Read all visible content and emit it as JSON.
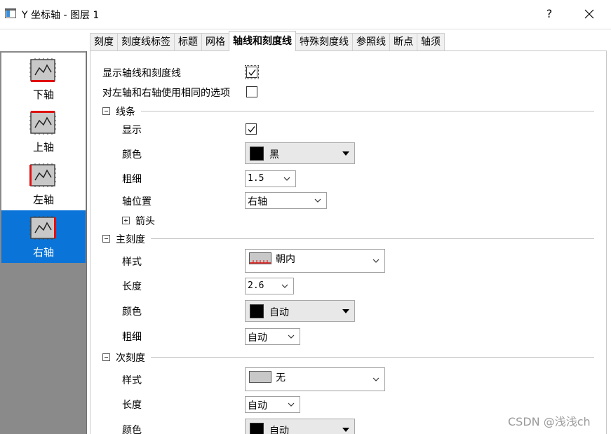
{
  "window": {
    "title": "Y 坐标轴 - 图层 1",
    "help_label": "?",
    "icons": {
      "app": "window-icon",
      "close": "close-icon"
    }
  },
  "tabs": [
    {
      "label": "刻度",
      "active": false
    },
    {
      "label": "刻度线标签",
      "active": false
    },
    {
      "label": "标题",
      "active": false
    },
    {
      "label": "网格",
      "active": false
    },
    {
      "label": "轴线和刻度线",
      "active": true
    },
    {
      "label": "特殊刻度线",
      "active": false
    },
    {
      "label": "参照线",
      "active": false
    },
    {
      "label": "断点",
      "active": false
    },
    {
      "label": "轴须",
      "active": false
    }
  ],
  "axes": [
    {
      "label": "下轴",
      "icon": "bottom-axis-icon",
      "selected": false
    },
    {
      "label": "上轴",
      "icon": "top-axis-icon",
      "selected": false
    },
    {
      "label": "左轴",
      "icon": "left-axis-icon",
      "selected": false
    },
    {
      "label": "右轴",
      "icon": "right-axis-icon",
      "selected": true
    }
  ],
  "options": {
    "show_axis_label": "显示轴线和刻度线",
    "show_axis_checked": true,
    "same_options_label": "对左轴和右轴使用相同的选项",
    "same_options_checked": false
  },
  "line": {
    "header": "线条",
    "show_label": "显示",
    "show_checked": true,
    "color_label": "颜色",
    "color_value": "黑",
    "color_hex": "#000000",
    "width_label": "粗细",
    "width_value": "1.5",
    "position_label": "轴位置",
    "position_value": "右轴",
    "arrow_label": "箭头"
  },
  "major": {
    "header": "主刻度",
    "style_label": "样式",
    "style_value": "朝内",
    "length_label": "长度",
    "length_value": "2.6",
    "color_label": "颜色",
    "color_value": "自动",
    "color_hex": "#000000",
    "width_label": "粗细",
    "width_value": "自动"
  },
  "minor": {
    "header": "次刻度",
    "style_label": "样式",
    "style_value": "无",
    "length_label": "长度",
    "length_value": "自动",
    "color_label": "颜色",
    "color_value": "自动",
    "color_hex": "#000000"
  },
  "watermark": "CSDN @浅浅ch",
  "colors": {
    "selection": "#0a74d8",
    "axis_highlight": "#e01010",
    "panel_bg": "#8a8a8a"
  }
}
